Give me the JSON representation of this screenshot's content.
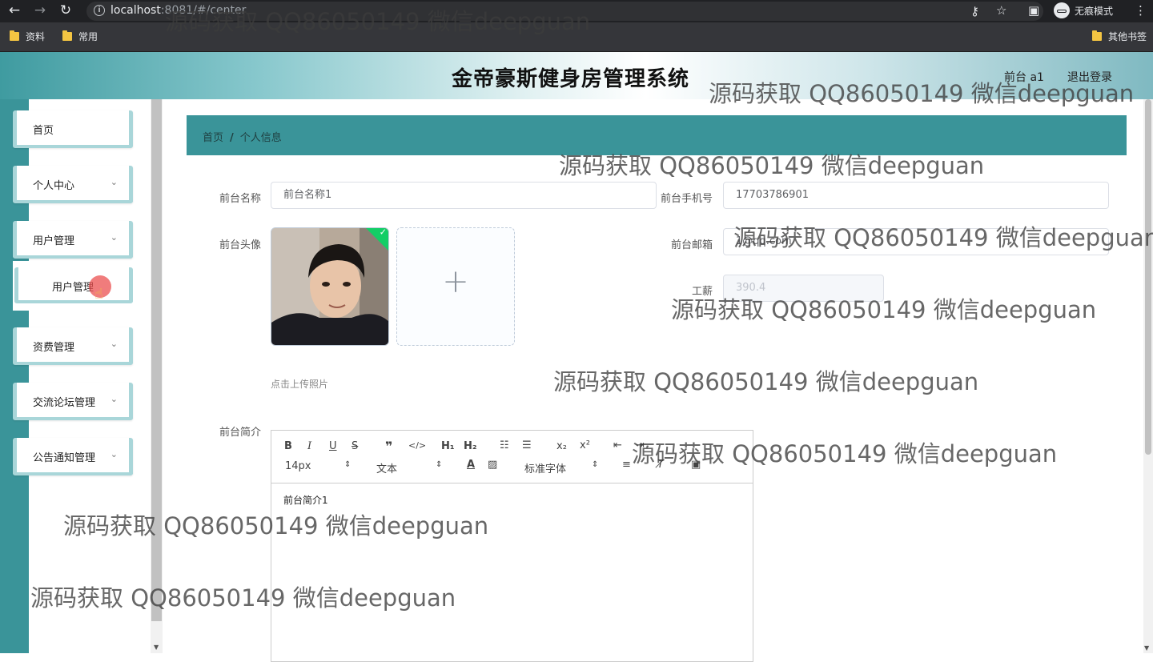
{
  "browser": {
    "url_host": "localhost",
    "url_rest": ":8081/#/center",
    "incognito_label": "无痕模式",
    "bookmarks": [
      "资料",
      "常用"
    ],
    "other_bookmarks": "其他书签"
  },
  "header": {
    "title": "金帝豪斯健身房管理系统",
    "user": "前台 a1",
    "logout": "退出登录"
  },
  "sidebar": {
    "items": [
      {
        "label": "首页",
        "chevron": ""
      },
      {
        "label": "个人中心",
        "chevron": "⌄"
      },
      {
        "label": "用户管理",
        "chevron": "⌄"
      },
      {
        "label": "资费管理",
        "chevron": "⌄"
      },
      {
        "label": "交流论坛管理",
        "chevron": "⌄"
      },
      {
        "label": "公告通知管理",
        "chevron": "⌄"
      }
    ],
    "subitem": "用户管理"
  },
  "breadcrumb": {
    "home": "首页",
    "separator": "/",
    "current": "个人信息"
  },
  "form": {
    "name_label": "前台名称",
    "name_value": "前台名称1",
    "phone_label": "前台手机号",
    "phone_value": "17703786901",
    "avatar_label": "前台头像",
    "email_label": "前台邮箱",
    "email_value": "1@qq.com",
    "salary_label": "工薪",
    "salary_value": "390.4",
    "upload_tip": "点击上传照片",
    "intro_label": "前台简介"
  },
  "editor": {
    "font_size": "14px",
    "block_type": "文本",
    "font_family": "标准字体",
    "content": "前台简介1"
  },
  "watermark": "源码获取 QQ86050149 微信deepguan",
  "colors": {
    "teal": "#3a9499",
    "light_teal": "#a9d6d9"
  }
}
